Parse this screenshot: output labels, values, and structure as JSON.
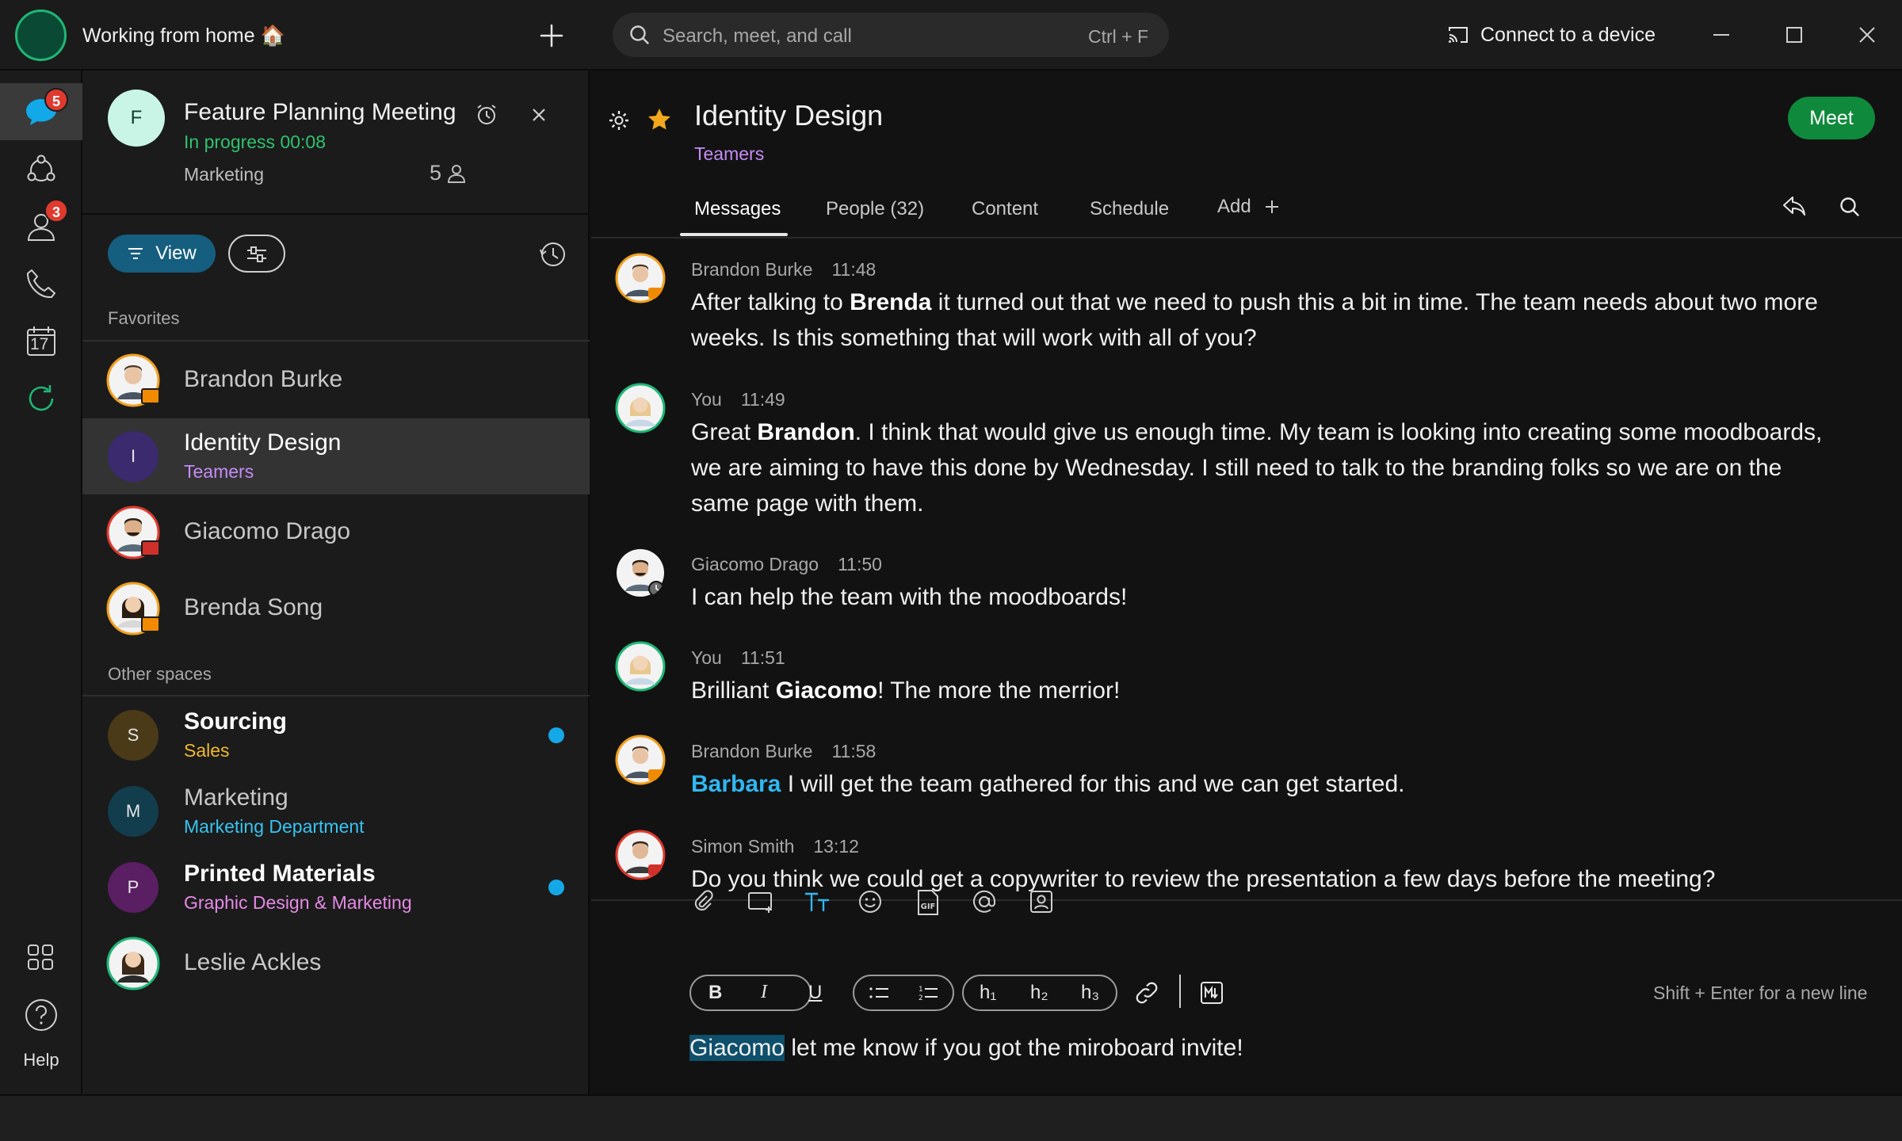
{
  "topbar": {
    "status": "Working from home 🏠",
    "search_placeholder": "Search, meet, and call",
    "search_shortcut": "Ctrl + F",
    "connect_label": "Connect to a device"
  },
  "rail": {
    "messages_badge": "5",
    "contacts_badge": "3",
    "calendar_day": "17",
    "help_label": "Help"
  },
  "meeting": {
    "avatar_letter": "F",
    "title": "Feature Planning Meeting",
    "status": "In progress 00:08",
    "team": "Marketing",
    "participants": "5"
  },
  "list": {
    "view_label": "View",
    "favorites_label": "Favorites",
    "other_label": "Other spaces",
    "favorites": [
      {
        "name": "Brandon Burke"
      },
      {
        "name": "Identity Design",
        "sub": "Teamers",
        "letter": "I"
      },
      {
        "name": "Giacomo Drago"
      },
      {
        "name": "Brenda Song"
      }
    ],
    "others": [
      {
        "name": "Sourcing",
        "sub": "Sales",
        "letter": "S"
      },
      {
        "name": "Marketing",
        "sub": "Marketing Department",
        "letter": "M"
      },
      {
        "name": "Printed Materials",
        "sub": "Graphic Design & Marketing",
        "letter": "P"
      },
      {
        "name": "Leslie Ackles"
      }
    ]
  },
  "space": {
    "title": "Identity Design",
    "team": "Teamers",
    "meet_label": "Meet",
    "tabs": [
      "Messages",
      "People (32)",
      "Content",
      "Schedule",
      "Add"
    ]
  },
  "messages": [
    {
      "author": "Brandon Burke",
      "time": "11:48",
      "pre": "After talking to ",
      "bold": "Brenda",
      "post": " it turned out that we need to push this a bit in time. The team needs about two more weeks. Is this something that will work with all of you?"
    },
    {
      "author": "You",
      "time": "11:49",
      "pre": "Great ",
      "bold": "Brandon",
      "post": ". I think that would give us enough time. My team is looking into creating some moodboards, we are aiming to have this done by Wednesday. I still need to talk to the branding folks so we are on the same page with them."
    },
    {
      "author": "Giacomo Drago",
      "time": "11:50",
      "pre": "I can help the team with the moodboards!",
      "bold": "",
      "post": ""
    },
    {
      "author": "You",
      "time": "11:51",
      "pre": "Brilliant ",
      "bold": "Giacomo",
      "post": "! The more the merrior!"
    },
    {
      "author": "Brandon Burke",
      "time": "11:58",
      "pre": "",
      "mention": "Barbara",
      "post": " I will get the team gathered for this and we can get started."
    },
    {
      "author": "Simon Smith",
      "time": "13:12",
      "pre": "Do you think we could get a copywriter to review the presentation a few days before the meeting?",
      "bold": "",
      "post": ""
    }
  ],
  "composer": {
    "fmt_h1": "h₁",
    "fmt_h2": "h₂",
    "fmt_h3": "h₃",
    "hint": "Shift + Enter for a new line",
    "draft_mention": "Giacomo",
    "draft_text": " let me know if you got the miroboard invite!"
  },
  "colors": {
    "accent_green": "#0f8a3c",
    "presence_green": "#2fc26e",
    "unread_blue": "#14a8e6",
    "team_purple": "#c48cf5",
    "badge_red": "#e03a2e"
  }
}
